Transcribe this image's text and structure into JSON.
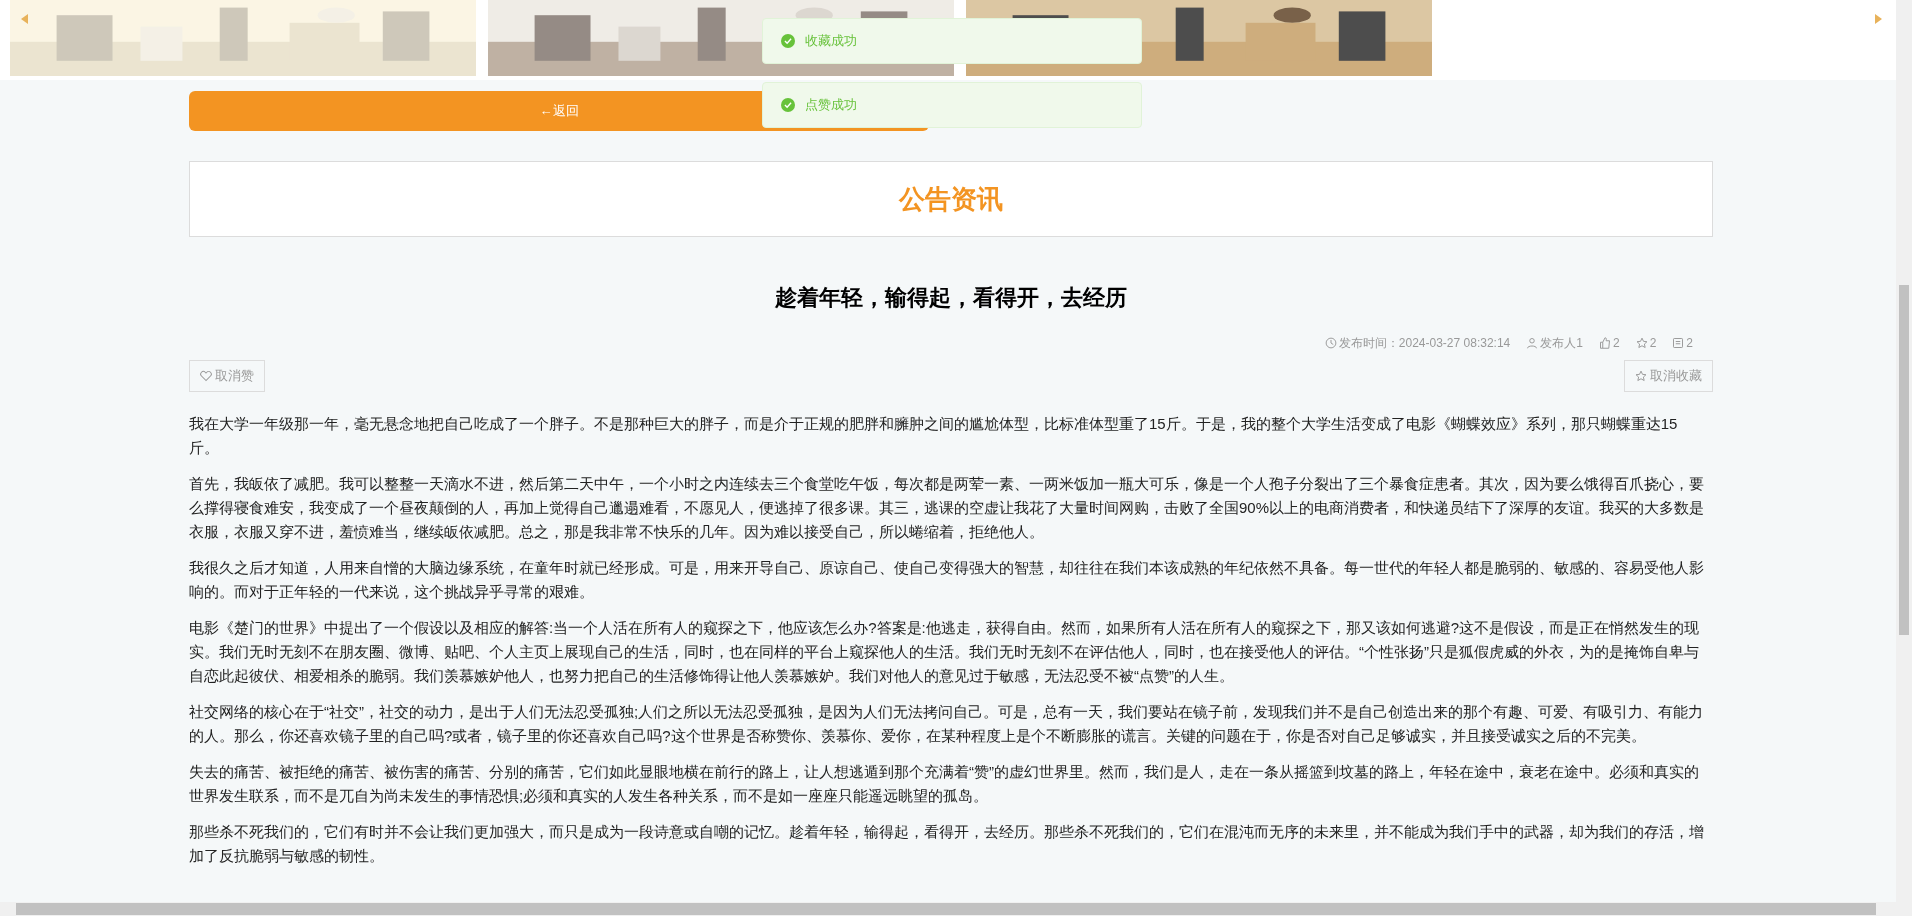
{
  "toasts": [
    {
      "text": "收藏成功"
    },
    {
      "text": "点赞成功"
    }
  ],
  "back_button": {
    "label": "←返回"
  },
  "section_title": "公告资讯",
  "article": {
    "title": "趁着年轻，输得起，看得开，去经历",
    "meta": [
      {
        "kind": "clock",
        "text": "发布时间：2024-03-27 08:32:14"
      },
      {
        "kind": "user",
        "text": "发布人1"
      },
      {
        "kind": "thumb",
        "text": "2"
      },
      {
        "kind": "star",
        "text": "2"
      },
      {
        "kind": "comment",
        "text": "2"
      }
    ],
    "like_button": {
      "label": "取消赞"
    },
    "favorite_button": {
      "label": "取消收藏"
    },
    "paragraphs": [
      "我在大学一年级那一年，毫无悬念地把自己吃成了一个胖子。不是那种巨大的胖子，而是介于正规的肥胖和臃肿之间的尴尬体型，比标准体型重了15斤。于是，我的整个大学生活变成了电影《蝴蝶效应》系列，那只蝴蝶重达15斤。",
      "首先，我皈依了减肥。我可以整整一天滴水不进，然后第二天中午，一个小时之内连续去三个食堂吃午饭，每次都是两荤一素、一两米饭加一瓶大可乐，像是一个人孢子分裂出了三个暴食症患者。其次，因为要么饿得百爪挠心，要么撑得寝食难安，我变成了一个昼夜颠倒的人，再加上觉得自己邋遢难看，不愿见人，便逃掉了很多课。其三，逃课的空虚让我花了大量时间网购，击败了全国90%以上的电商消费者，和快递员结下了深厚的友谊。我买的大多数是衣服，衣服又穿不进，羞愤难当，继续皈依减肥。总之，那是我非常不快乐的几年。因为难以接受自己，所以蜷缩着，拒绝他人。",
      "我很久之后才知道，人用来自憎的大脑边缘系统，在童年时就已经形成。可是，用来开导自己、原谅自己、使自己变得强大的智慧，却往往在我们本该成熟的年纪依然不具备。每一世代的年轻人都是脆弱的、敏感的、容易受他人影响的。而对于正年轻的一代来说，这个挑战异乎寻常的艰难。",
      "电影《楚门的世界》中提出了一个假设以及相应的解答:当一个人活在所有人的窥探之下，他应该怎么办?答案是:他逃走，获得自由。然而，如果所有人活在所有人的窥探之下，那又该如何逃避?这不是假设，而是正在悄然发生的现实。我们无时无刻不在朋友圈、微博、贴吧、个人主页上展现自己的生活，同时，也在同样的平台上窥探他人的生活。我们无时无刻不在评估他人，同时，也在接受他人的评估。“个性张扬”只是狐假虎威的外衣，为的是掩饰自卑与自恋此起彼伏、相爱相杀的脆弱。我们羡慕嫉妒他人，也努力把自己的生活修饰得让他人羡慕嫉妒。我们对他人的意见过于敏感，无法忍受不被“点赞”的人生。",
      "社交网络的核心在于“社交”，社交的动力，是出于人们无法忍受孤独;人们之所以无法忍受孤独，是因为人们无法拷问自己。可是，总有一天，我们要站在镜子前，发现我们并不是自己创造出来的那个有趣、可爱、有吸引力、有能力的人。那么，你还喜欢镜子里的自己吗?或者，镜子里的你还喜欢自己吗?这个世界是否称赞你、羡慕你、爱你，在某种程度上是个不断膨胀的谎言。关键的问题在于，你是否对自己足够诚实，并且接受诚实之后的不完美。",
      "失去的痛苦、被拒绝的痛苦、被伤害的痛苦、分别的痛苦，它们如此显眼地横在前行的路上，让人想逃遁到那个充满着“赞”的虚幻世界里。然而，我们是人，走在一条从摇篮到坟墓的路上，年轻在途中，衰老在途中。必须和真实的世界发生联系，而不是兀自为尚未发生的事情恐惧;必须和真实的人发生各种关系，而不是如一座座只能遥远眺望的孤岛。",
      "那些杀不死我们的，它们有时并不会让我们更加强大，而只是成为一段诗意或自嘲的记忆。趁着年轻，输得起，看得开，去经历。那些杀不死我们的，它们在混沌而无序的未来里，并不能成为我们手中的武器，却为我们的存活，增加了反抗脆弱与敏感的韧性。"
    ]
  }
}
